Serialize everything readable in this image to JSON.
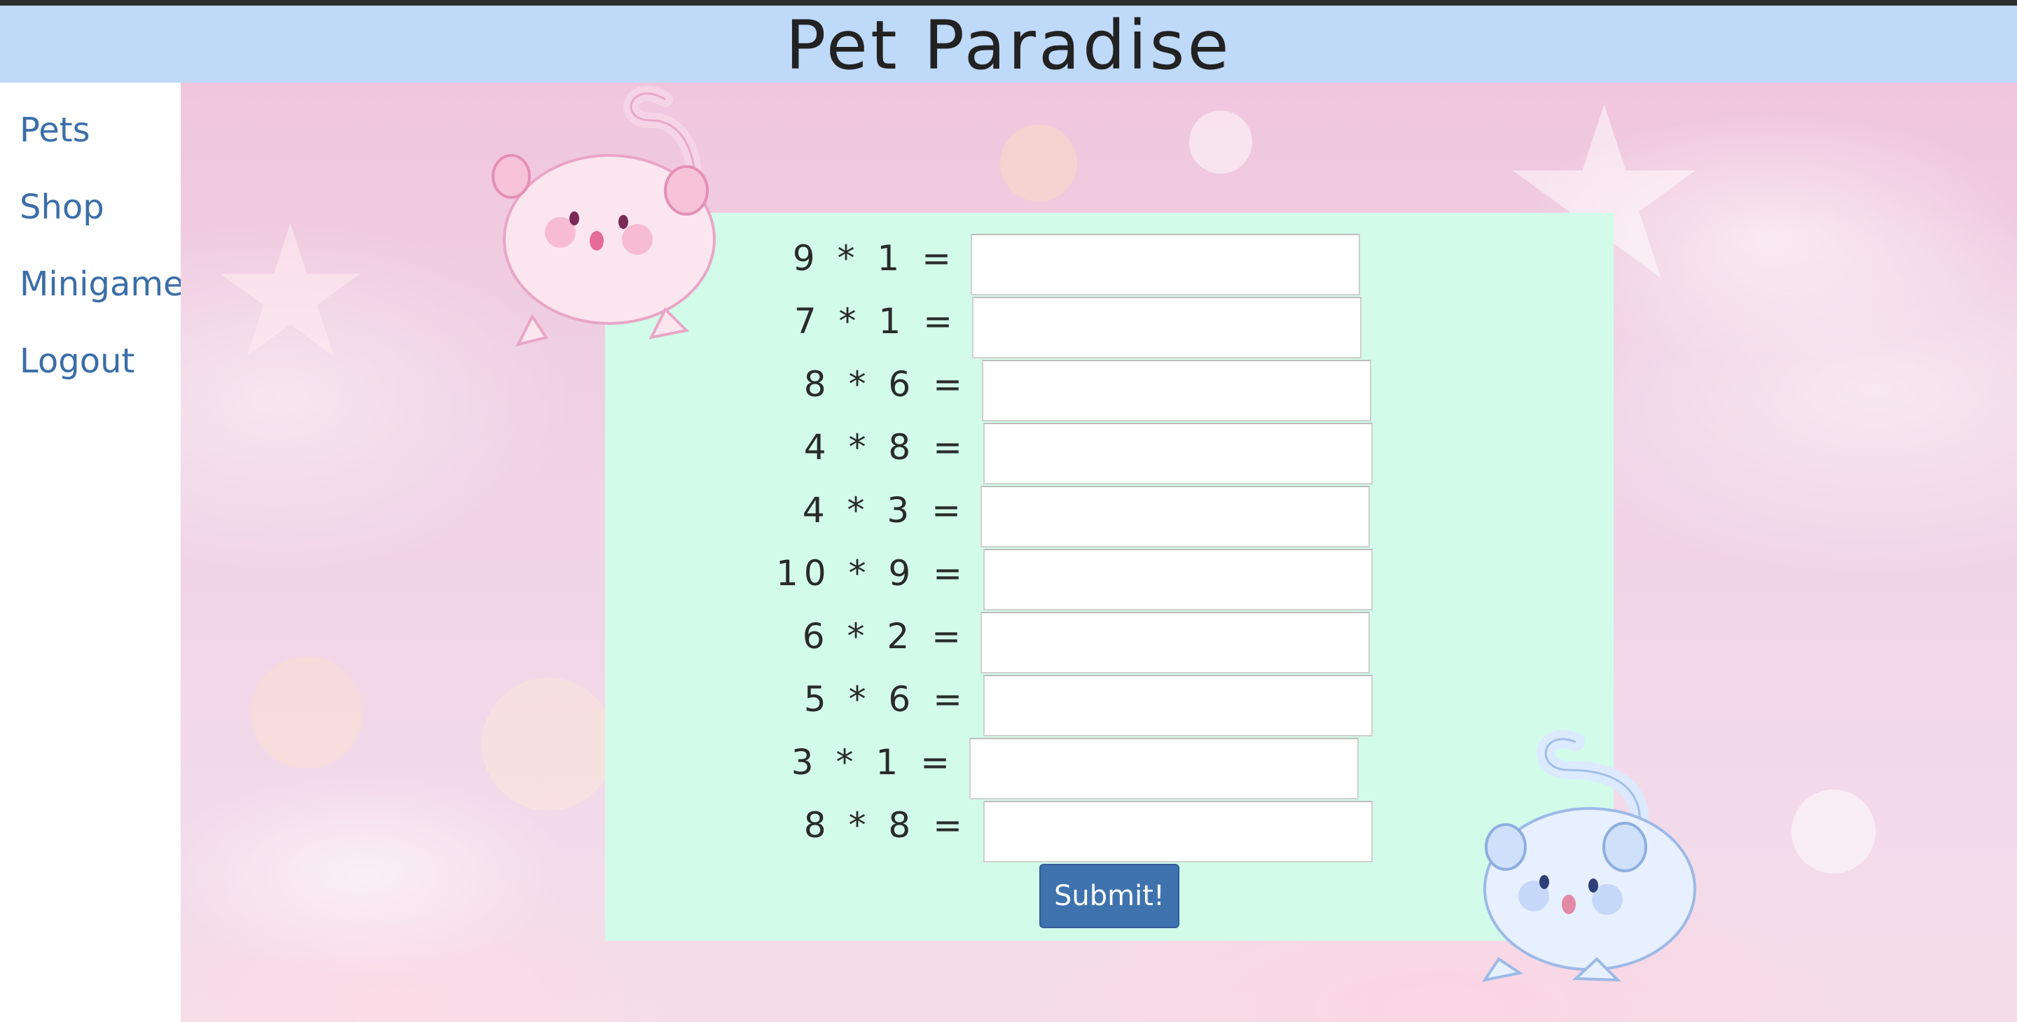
{
  "header": {
    "title": "Pet Paradise"
  },
  "sidebar": {
    "items": [
      {
        "label": "Pets"
      },
      {
        "label": "Shop"
      },
      {
        "label": "Minigame"
      },
      {
        "label": "Logout"
      }
    ]
  },
  "quiz": {
    "questions": [
      {
        "expr": "9 * 1 =",
        "value": ""
      },
      {
        "expr": "7 * 1 =",
        "value": ""
      },
      {
        "expr": "8 * 6 =",
        "value": ""
      },
      {
        "expr": "4 * 8 =",
        "value": ""
      },
      {
        "expr": "4 * 3 =",
        "value": ""
      },
      {
        "expr": "10 * 9 =",
        "value": ""
      },
      {
        "expr": "6 * 2 =",
        "value": ""
      },
      {
        "expr": "5 * 6 =",
        "value": ""
      },
      {
        "expr": "3 * 1 =",
        "value": ""
      },
      {
        "expr": "8 * 8 =",
        "value": ""
      }
    ],
    "submit_label": "Submit!"
  },
  "colors": {
    "header_bg": "#bfd9f9",
    "panel_bg": "#d2fbea",
    "nav_link": "#3b6ea8",
    "submit_bg": "#3f73ae"
  },
  "decor": {
    "pink_pet": "pink-pet-illustration",
    "blue_pet": "blue-pet-illustration"
  }
}
